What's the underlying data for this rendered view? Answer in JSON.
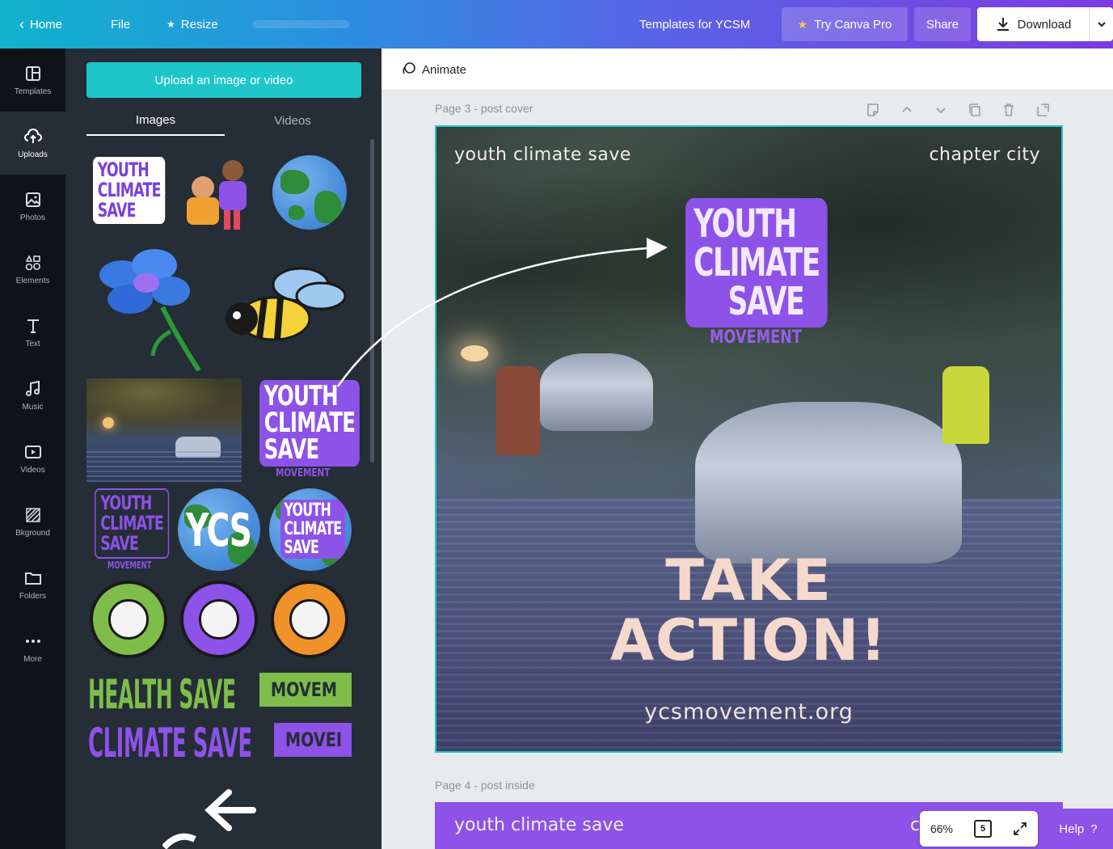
{
  "topbar": {
    "home": "Home",
    "file": "File",
    "resize": "Resize",
    "title": "Templates for YCSM",
    "try_pro": "Try Canva Pro",
    "share": "Share",
    "download": "Download"
  },
  "rail": [
    {
      "label": "Templates",
      "icon": "templates-icon"
    },
    {
      "label": "Uploads",
      "icon": "upload-cloud-icon"
    },
    {
      "label": "Photos",
      "icon": "photos-icon"
    },
    {
      "label": "Elements",
      "icon": "elements-icon"
    },
    {
      "label": "Text",
      "icon": "text-icon"
    },
    {
      "label": "Music",
      "icon": "music-icon"
    },
    {
      "label": "Videos",
      "icon": "video-icon"
    },
    {
      "label": "Bkground",
      "icon": "background-icon"
    },
    {
      "label": "Folders",
      "icon": "folder-icon"
    },
    {
      "label": "More",
      "icon": "more-dots-icon"
    }
  ],
  "panel": {
    "upload_button": "Upload an image or video",
    "tabs": [
      "Images",
      "Videos"
    ],
    "stickers": {
      "ycs_lines": "YOUTH\nCLIMATE\nSAVE",
      "movement": "MOVEMENT",
      "ycs_short": "YCS",
      "health": "HEALTH SAVE",
      "climate": "CLIMATE SAVE",
      "movem": "MOVEM",
      "mover": "MOVEI"
    }
  },
  "editor": {
    "animate": "Animate",
    "page3_label": "Page 3 - post cover",
    "page4_label": "Page 4 - post inside",
    "canvas": {
      "top_left": "youth climate save",
      "top_right": "chapter city",
      "logo_lines": "YOUTH\nCLIMATE\n    SAVE",
      "logo_movement": "MOVEMENT",
      "take": "TAKE",
      "action": "ACTION!",
      "url": "ycsmovement.org"
    },
    "canvas2": {
      "top_left": "youth climate save",
      "partial_right": "c"
    },
    "zoom": "66%",
    "pages_count": "5",
    "help": "Help"
  },
  "colors": {
    "accent_teal": "#1ec6c9",
    "brand_purple": "#8d52e8",
    "rail_bg": "#0e1318",
    "panel_bg": "#252d36"
  }
}
